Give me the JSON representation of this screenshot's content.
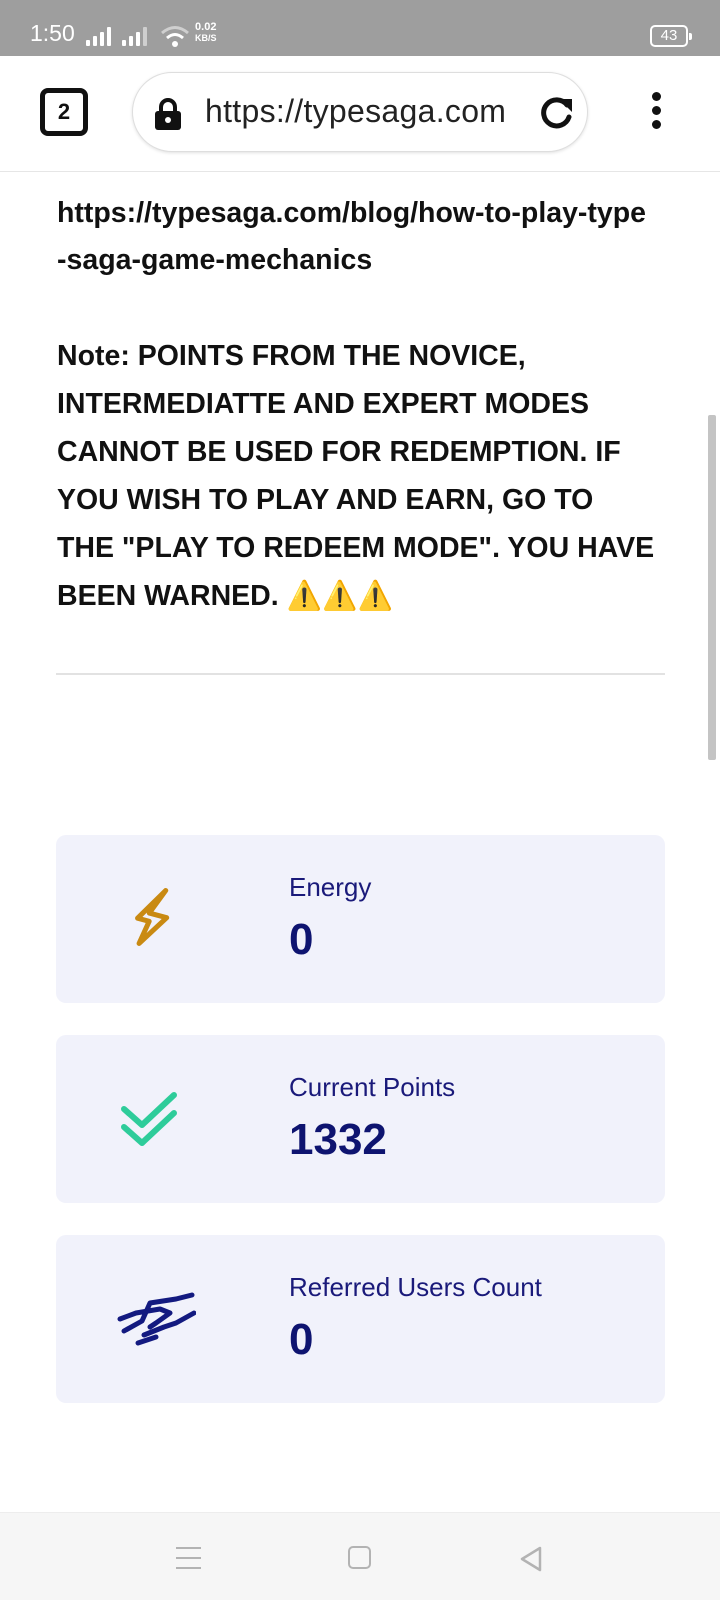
{
  "status_bar": {
    "time": "1:50",
    "net_speed_value": "0.02",
    "net_speed_unit": "KB/S",
    "battery": "43"
  },
  "browser": {
    "tab_count": "2",
    "url": "https://typesaga.com"
  },
  "content": {
    "link": "https://typesaga.com/blog/how-to-play-type-saga-game-mechanics",
    "note": "Note: POINTS FROM THE NOVICE, INTERMEDIATTE AND EXPERT MODES CANNOT BE USED FOR REDEMPTION. IF YOU WISH TO PLAY AND EARN, GO TO THE \"PLAY TO REDEEM MODE\". YOU HAVE BEEN WARNED.",
    "warning_emojis": "⚠️⚠️⚠️"
  },
  "stats": [
    {
      "label": "Energy",
      "value": "0",
      "icon": "lightning-icon",
      "color": "#c98a12"
    },
    {
      "label": "Current Points",
      "value": "1332",
      "icon": "double-check-icon",
      "color": "#2ecc9a"
    },
    {
      "label": "Referred Users Count",
      "value": "0",
      "icon": "handshake-icon",
      "color": "#131a80"
    }
  ]
}
